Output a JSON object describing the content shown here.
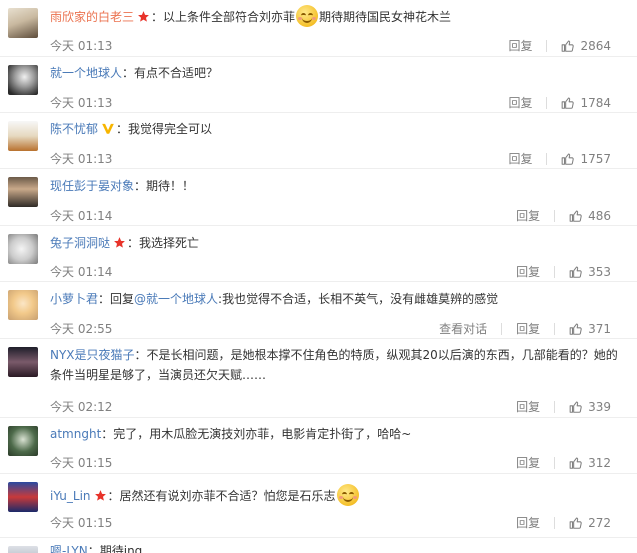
{
  "comments": [
    {
      "username": "雨欣家的白老三",
      "has_star": true,
      "has_v": false,
      "text_pre": "：以上条件全部符合刘亦菲",
      "has_emoji": true,
      "text_post": "期待期待国民女神花木兰",
      "time": "今天 01:13",
      "reply_label": "回复",
      "likes": "2864"
    },
    {
      "username": "就一个地球人",
      "has_star": false,
      "has_v": false,
      "text_pre": "：有点不合适吧？",
      "time": "今天 01:13",
      "reply_label": "回复",
      "likes": "1784"
    },
    {
      "username": "陈不忧郁",
      "has_star": false,
      "has_v": true,
      "text_pre": "：我觉得完全可以",
      "time": "今天 01:13",
      "reply_label": "回复",
      "likes": "1757"
    },
    {
      "username": "现任彭于晏对象",
      "has_star": false,
      "has_v": false,
      "text_pre": "：期待！！",
      "time": "今天 01:14",
      "reply_label": "回复",
      "likes": "486"
    },
    {
      "username": "兔子洞洞哒",
      "has_star": true,
      "has_v": false,
      "text_pre": "：我选择死亡",
      "time": "今天 01:14",
      "reply_label": "回复",
      "likes": "353"
    },
    {
      "username": "小萝卜君",
      "has_star": false,
      "has_v": false,
      "text_reply_prefix": "：回复",
      "text_reply_to": "@就一个地球人",
      "text_pre": ":我也觉得不合适，长相不英气，没有雌雄莫辨的感觉",
      "time": "今天 02:55",
      "view_thread_label": "查看对话",
      "reply_label": "回复",
      "likes": "371"
    },
    {
      "username": "NYX是只夜猫子",
      "has_star": false,
      "has_v": false,
      "text_pre": "：不是长相问题，是她根本撑不住角色的特质，纵观其20以后演的东西，几部能看的？她的条件当明星是够了，当演员还欠天赋……",
      "time": "今天 02:12",
      "reply_label": "回复",
      "likes": "339"
    },
    {
      "username": "atmnght",
      "has_star": false,
      "has_v": false,
      "text_pre": "：完了，用木瓜脸无演技刘亦菲，电影肯定扑街了，哈哈~",
      "time": "今天 01:15",
      "reply_label": "回复",
      "likes": "312"
    },
    {
      "username": "iYu_Lin",
      "has_star": true,
      "has_v": false,
      "text_pre": "：居然还有说刘亦菲不合适？怕您是石乐志",
      "has_emoji": true,
      "time": "今天 01:15",
      "reply_label": "回复",
      "likes": "272"
    },
    {
      "username": "嗯-LYN",
      "has_star": false,
      "has_v": false,
      "text_pre": "：期待ing"
    }
  ],
  "colors": {
    "username_orange": "#eb7350",
    "username_blue": "#4a7ab8",
    "meta_gray": "#808080",
    "star_red": "#e8332a",
    "v_badge_yellow": "#f7b500"
  },
  "icons": {
    "like": "thumbs-up-icon",
    "star": "star-badge-icon",
    "v_badge": "v-verified-icon",
    "emoji": "smiley-emoji-icon"
  }
}
